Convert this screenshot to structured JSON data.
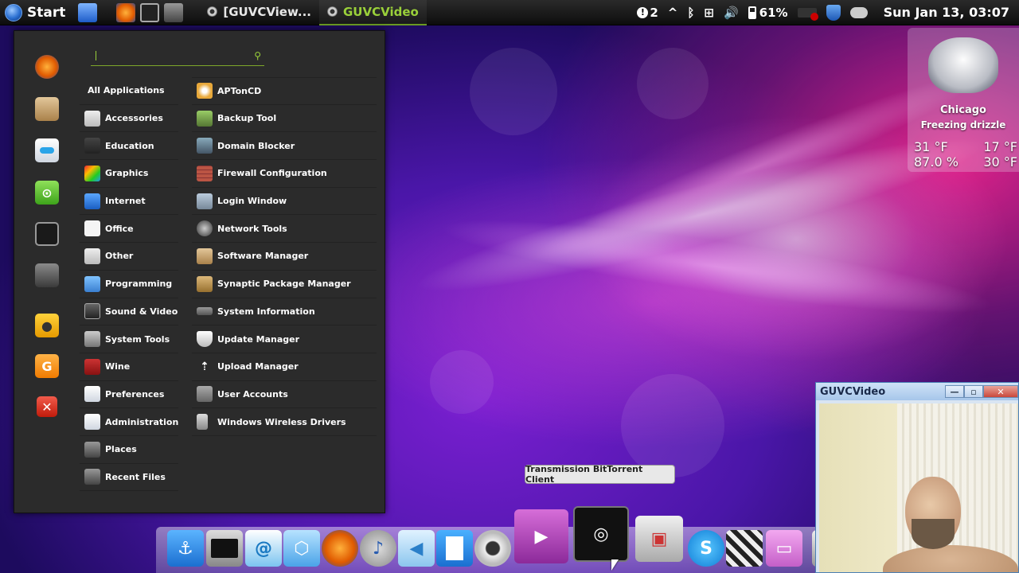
{
  "top_panel": {
    "start_label": "Start",
    "tasks": [
      {
        "label": "[GUVCView..."
      },
      {
        "label": "GUVCVideo"
      }
    ],
    "tray": {
      "notifications": "2",
      "battery": "61%",
      "clock": "Sun Jan 13, 03:07"
    }
  },
  "menu": {
    "search_placeholder": "",
    "favorites": [
      "firefox-icon",
      "package-icon",
      "toggle-icon",
      "chat-icon",
      "terminal-icon",
      "window-icon",
      "lock-icon",
      "logout-icon",
      "quit-icon"
    ],
    "categories": [
      "All Applications",
      "Accessories",
      "Education",
      "Graphics",
      "Internet",
      "Office",
      "Other",
      "Programming",
      "Sound & Video",
      "System Tools",
      "Wine",
      "Preferences",
      "Administration",
      "Places",
      "Recent Files"
    ],
    "apps": [
      "APTonCD",
      "Backup Tool",
      "Domain Blocker",
      "Firewall Configuration",
      "Login Window",
      "Network Tools",
      "Software Manager",
      "Synaptic Package Manager",
      "System Information",
      "Update Manager",
      "Upload Manager",
      "User Accounts",
      "Windows Wireless Drivers"
    ]
  },
  "weather": {
    "city": "Chicago",
    "condition": "Freezing drizzle",
    "temp_current": "31 °F",
    "temp_low": "17 °F",
    "humidity": "87.0 %",
    "feels_like": "30 °F"
  },
  "tooltip": {
    "text": "Transmission BitTorrent Client"
  },
  "dock_icons": [
    "anchor-icon",
    "terminal-icon",
    "mail-icon",
    "box-icon",
    "firefox-icon",
    "music-icon",
    "video-call-icon",
    "document-icon",
    "webcam-icon",
    "media-player-icon",
    "transmission-icon",
    "settings-icon",
    "skype-icon",
    "clapper-icon",
    "chat-icon",
    "trash-icon"
  ],
  "guvc_window": {
    "title": "GUVCVideo",
    "minimize": "—",
    "maximize": "▫",
    "close": "✕"
  },
  "colors": {
    "accent_green": "#9ad03a",
    "panel_bg": "#0d0d0d",
    "menu_bg": "#2b2b2b"
  }
}
